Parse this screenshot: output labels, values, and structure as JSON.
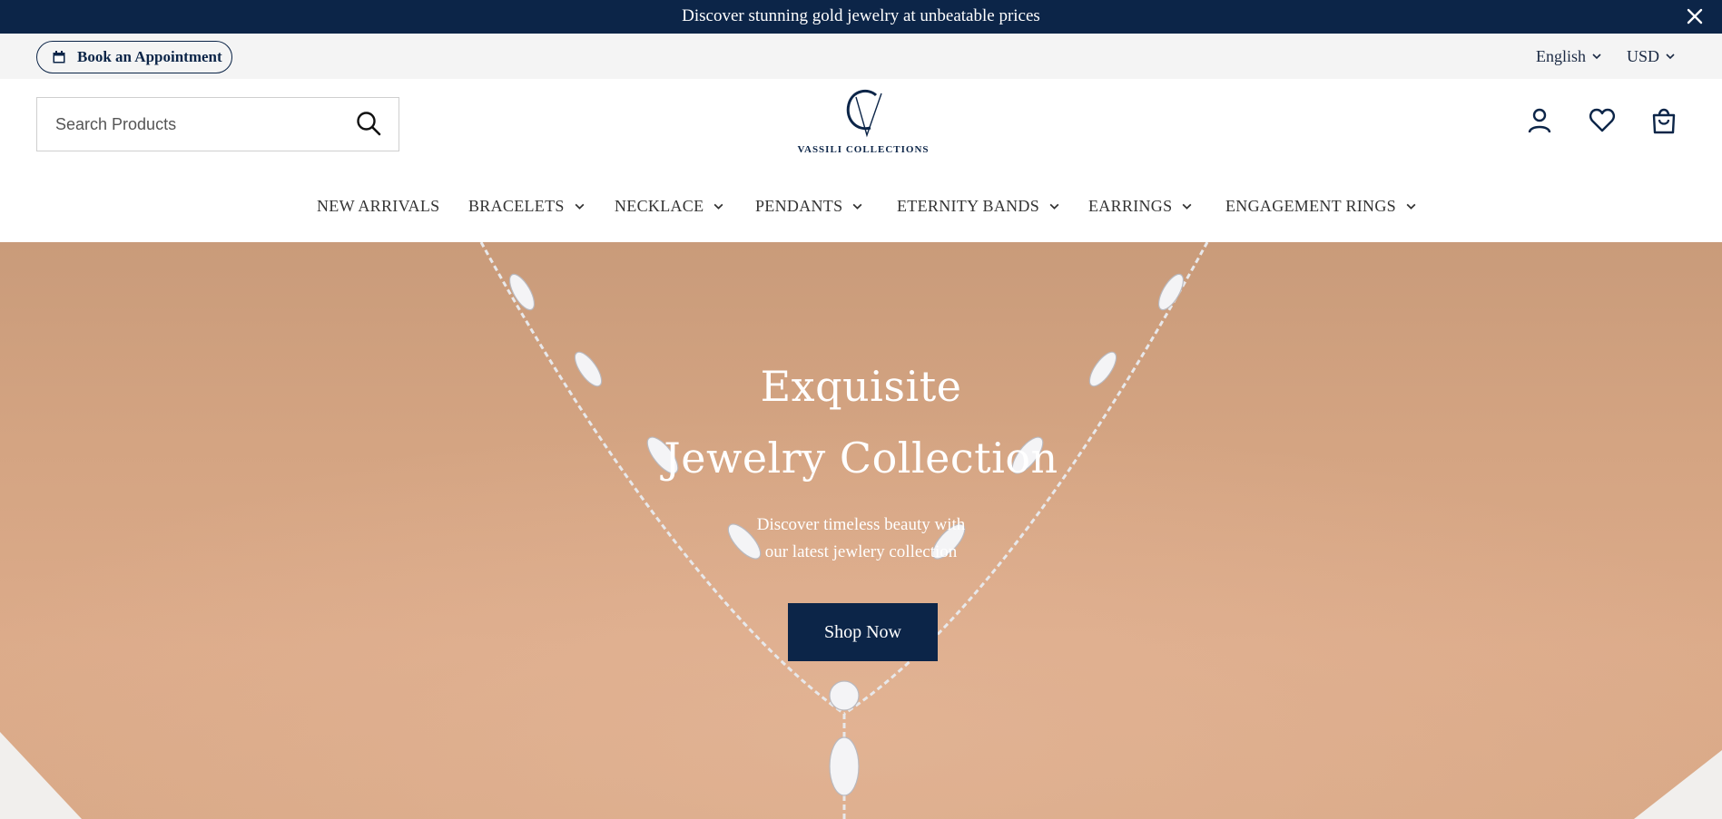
{
  "announcement": {
    "text": "Discover stunning gold jewelry at unbeatable prices",
    "close_icon": "close-icon"
  },
  "utility": {
    "appointment_label": "Book an Appointment",
    "appointment_icon": "calendar-icon",
    "language": "English",
    "currency": "USD"
  },
  "header": {
    "search_placeholder": "Search Products",
    "logo_text": "VASSILI COLLECTIONS",
    "icons": [
      "account-icon",
      "heart-icon",
      "shopping-bag-icon"
    ]
  },
  "nav": {
    "items": [
      {
        "label": "NEW ARRIVALS",
        "has_dropdown": false
      },
      {
        "label": "BRACELETS",
        "has_dropdown": true
      },
      {
        "label": "NECKLACE",
        "has_dropdown": true
      },
      {
        "label": "PENDANTS",
        "has_dropdown": true
      },
      {
        "label": "ETERNITY BANDS",
        "has_dropdown": true
      },
      {
        "label": "EARRINGS",
        "has_dropdown": true
      },
      {
        "label": "ENGAGEMENT RINGS",
        "has_dropdown": true
      }
    ]
  },
  "hero": {
    "title_line1": "Exquisite",
    "title_line2": "Jewelry Collection",
    "subtitle_line1": "Discover timeless beauty with",
    "subtitle_line2": "our latest jewlery collection",
    "cta_label": "Shop Now"
  },
  "colors": {
    "brand_navy": "#0c2548",
    "utility_bg": "#f4f4f4",
    "skin_tone": "#d4a482"
  }
}
